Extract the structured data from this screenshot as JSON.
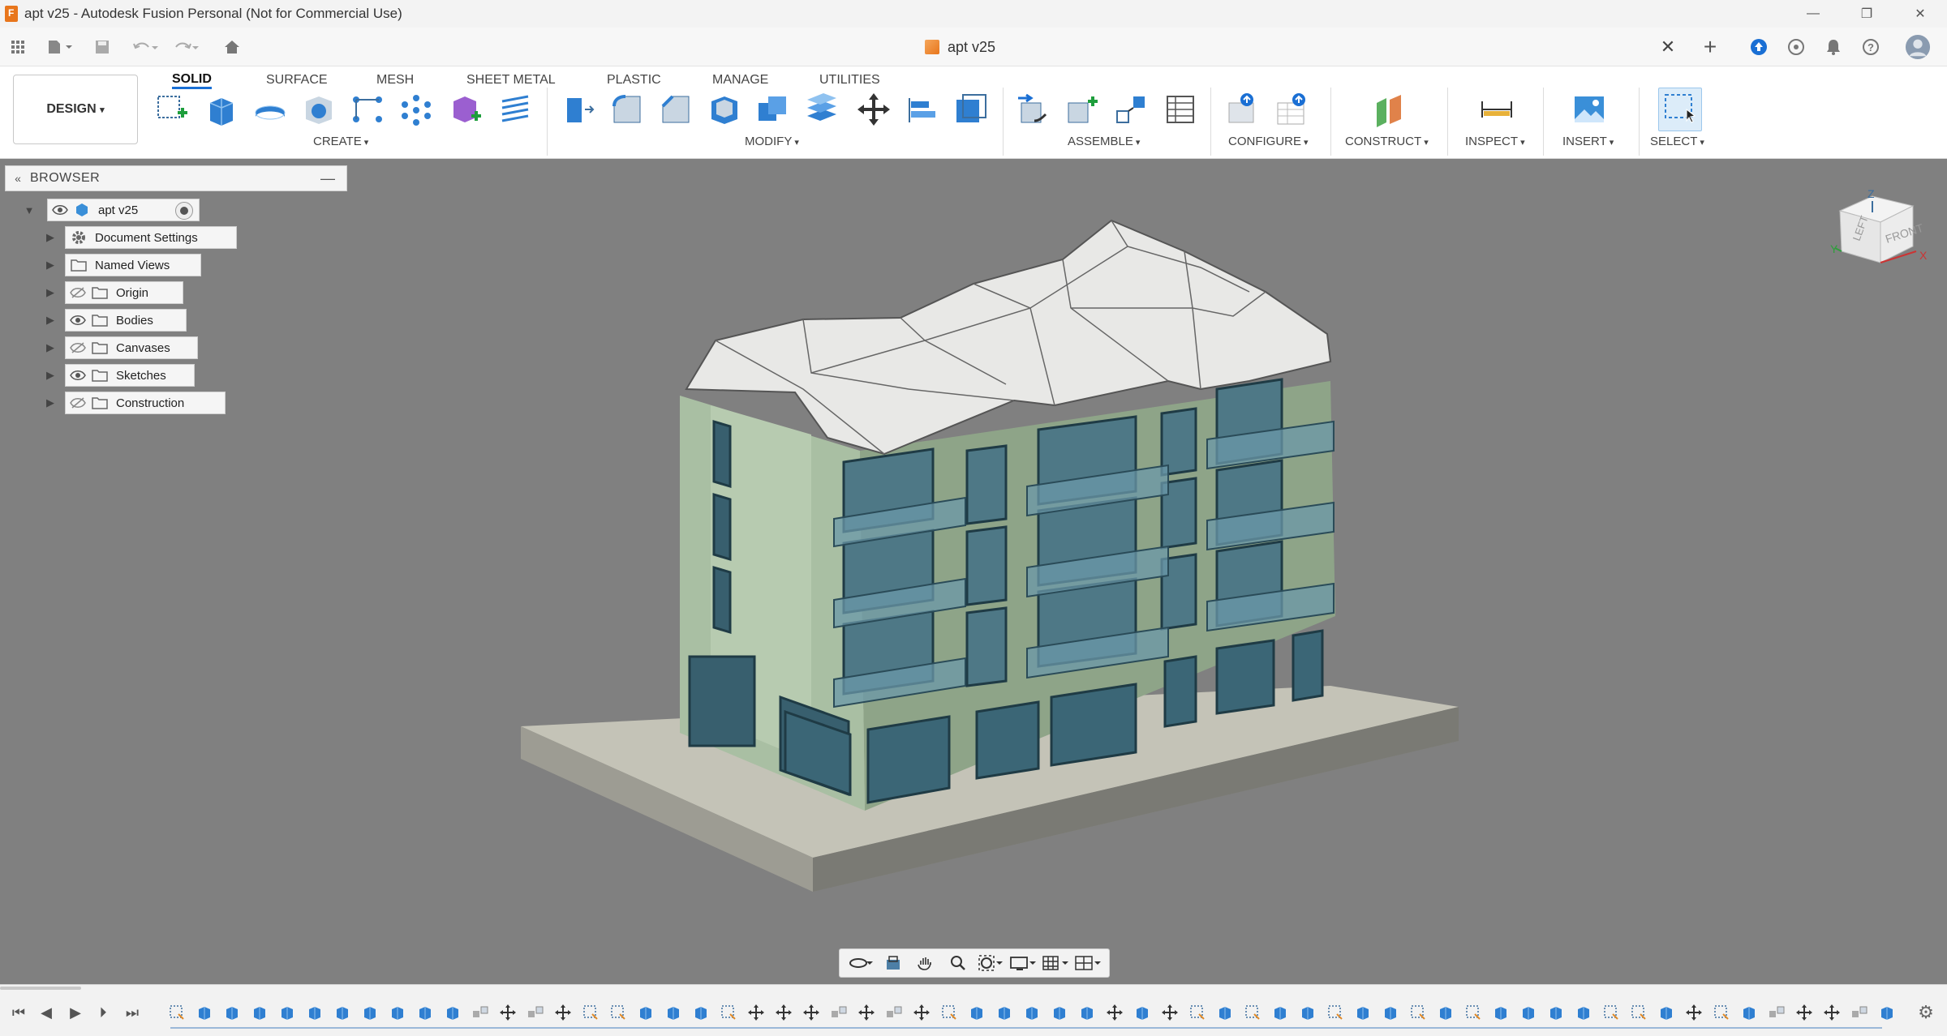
{
  "window": {
    "title": "apt v25 - Autodesk Fusion Personal (Not for Commercial Use)",
    "controls": [
      "minimize-icon",
      "restore-icon",
      "close-icon"
    ]
  },
  "tabbar": {
    "document_tab": "apt v25",
    "icons": [
      "grid-icon",
      "file-icon",
      "save-icon",
      "undo-icon",
      "redo-icon",
      "home-icon",
      "plus-icon",
      "upload-icon",
      "clock-icon",
      "bell-icon",
      "help-icon",
      "avatar"
    ]
  },
  "toolbar": {
    "workspace_button": "DESIGN",
    "tabs": [
      "SOLID",
      "SURFACE",
      "MESH",
      "SHEET METAL",
      "PLASTIC",
      "MANAGE",
      "UTILITIES"
    ],
    "active_tab": "SOLID",
    "groups": [
      "CREATE",
      "MODIFY",
      "ASSEMBLE",
      "CONFIGURE",
      "CONSTRUCT",
      "INSPECT",
      "INSERT",
      "SELECT"
    ]
  },
  "browser": {
    "title": "BROWSER",
    "root": "apt v25",
    "nodes": [
      {
        "label": "Document Settings",
        "icon": "gear-icon",
        "visibility": "none"
      },
      {
        "label": "Named Views",
        "icon": "folder-icon",
        "visibility": "none"
      },
      {
        "label": "Origin",
        "icon": "folder-icon",
        "visibility": "hidden"
      },
      {
        "label": "Bodies",
        "icon": "folder-icon",
        "visibility": "visible"
      },
      {
        "label": "Canvases",
        "icon": "folder-icon",
        "visibility": "hidden"
      },
      {
        "label": "Sketches",
        "icon": "folder-icon",
        "visibility": "visible"
      },
      {
        "label": "Construction",
        "icon": "folder-icon",
        "visibility": "hidden"
      }
    ]
  },
  "viewcube": {
    "left": "LEFT",
    "front": "FRONT",
    "axis_z": "Z",
    "axis_x": "X",
    "axis_y": "Y"
  },
  "colors": {
    "viewport_bg": "#808080",
    "accent_blue": "#1a6fd4",
    "building_green": "#9fb79a",
    "glass": "#3e6e80",
    "roof": "#ececea",
    "base": "#b9b9ae"
  },
  "navbar": {
    "icons": [
      "orbit-icon",
      "look-at-icon",
      "pan-icon",
      "zoom-icon",
      "fit-icon",
      "display-settings-icon",
      "grid-icon",
      "viewports-icon"
    ]
  },
  "timeline": {
    "controls": [
      "skip-start-icon",
      "step-back-icon",
      "play-icon",
      "step-forward-icon",
      "skip-end-icon"
    ],
    "feature_count": 63
  }
}
